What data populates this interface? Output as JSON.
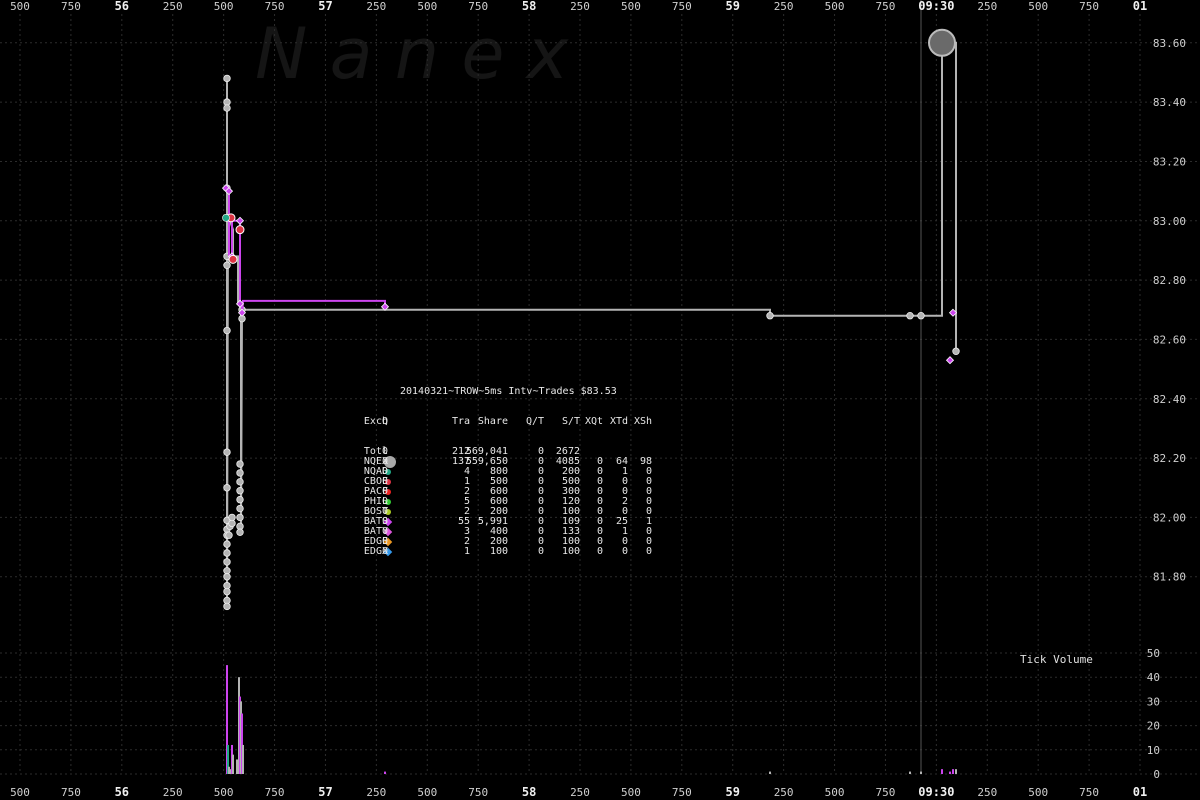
{
  "chart_data": {
    "type": "scatter",
    "title": "20140321~TROW~5ms Intv~Trades $83.53",
    "watermark": "N a n e x",
    "volume_label": "Tick Volume",
    "x_axis_ticks": [
      "500",
      "750",
      "56",
      "250",
      "500",
      "750",
      "57",
      "250",
      "500",
      "750",
      "58",
      "250",
      "500",
      "750",
      "59",
      "250",
      "500",
      "750",
      "09:30",
      "250",
      "500",
      "750",
      "01"
    ],
    "price_axis": {
      "ticks": [
        "83.60",
        "83.40",
        "83.20",
        "83.00",
        "82.80",
        "82.60",
        "82.40",
        "82.20",
        "82.00",
        "81.80"
      ],
      "ylim": [
        81.58,
        83.66
      ]
    },
    "volume_axis": {
      "ticks": [
        "50",
        "40",
        "30",
        "20",
        "10",
        "0"
      ],
      "ylim": [
        0,
        50
      ]
    },
    "x_range": [
      0,
      1200
    ],
    "colors": {
      "background": "#000000",
      "nqex": "#b4b4b4",
      "bats": "#cc44ee",
      "gridline": "#2c2c2c",
      "nqad": "#22aa88",
      "cboe": "#dd3344",
      "pacf": "#ee2222",
      "phil": "#33cc33",
      "bost": "#aacc22",
      "baty": "#dd55dd",
      "edge": "#ee9922",
      "edgx": "#3399ee"
    },
    "series": [
      {
        "name": "NQEX",
        "color": "#b4b4b4",
        "path": [
          [
            227,
            83.48
          ],
          [
            227,
            81.7
          ],
          [
            228,
            83.02
          ],
          [
            233,
            82.97
          ],
          [
            233,
            82.88
          ],
          [
            238,
            82.88
          ],
          [
            238,
            82.72
          ],
          [
            241,
            82.72
          ],
          [
            241,
            82.69
          ],
          [
            241,
            81.94
          ],
          [
            242,
            82.7
          ],
          [
            770,
            82.7
          ],
          [
            770,
            82.68
          ],
          [
            942,
            82.68
          ],
          [
            942,
            83.6
          ],
          [
            956,
            83.6
          ],
          [
            956,
            82.56
          ]
        ],
        "points": [
          [
            227,
            83.48
          ],
          [
            227,
            83.4
          ],
          [
            227,
            83.38
          ],
          [
            227,
            83.11
          ],
          [
            227,
            83.01
          ],
          [
            227,
            82.88
          ],
          [
            227,
            82.85
          ],
          [
            227,
            82.63
          ],
          [
            227,
            82.22
          ],
          [
            227,
            82.1
          ],
          [
            227,
            81.99
          ],
          [
            227,
            81.96
          ],
          [
            227,
            81.94
          ],
          [
            227,
            81.91
          ],
          [
            227,
            81.88
          ],
          [
            227,
            81.85
          ],
          [
            227,
            81.82
          ],
          [
            227,
            81.8
          ],
          [
            227,
            81.77
          ],
          [
            227,
            81.75
          ],
          [
            227,
            81.72
          ],
          [
            227,
            81.7
          ],
          [
            229,
            81.94
          ],
          [
            230,
            81.97
          ],
          [
            232,
            81.98
          ],
          [
            232,
            82.0
          ],
          [
            240,
            82.18
          ],
          [
            240,
            82.15
          ],
          [
            240,
            82.12
          ],
          [
            240,
            82.09
          ],
          [
            240,
            82.06
          ],
          [
            240,
            82.03
          ],
          [
            240,
            82.0
          ],
          [
            240,
            81.97
          ],
          [
            240,
            81.95
          ],
          [
            242,
            82.7
          ],
          [
            242,
            82.67
          ],
          [
            770,
            82.68
          ],
          [
            910,
            82.68
          ],
          [
            921,
            82.68
          ],
          [
            956,
            82.56
          ]
        ],
        "big_point": [
          942,
          83.6
        ]
      },
      {
        "name": "BATS",
        "color": "#cc44ee",
        "path": [
          [
            226,
            83.11
          ],
          [
            229,
            83.11
          ],
          [
            229,
            82.88
          ],
          [
            232,
            82.88
          ],
          [
            232,
            83.0
          ],
          [
            240,
            83.0
          ],
          [
            240,
            82.72
          ],
          [
            242,
            82.72
          ],
          [
            242,
            82.68
          ],
          [
            243,
            82.73
          ],
          [
            385,
            82.73
          ],
          [
            385,
            82.71
          ]
        ],
        "points": [
          [
            226,
            83.11
          ],
          [
            229,
            83.1
          ],
          [
            232,
            82.88
          ],
          [
            240,
            83.0
          ],
          [
            240,
            82.72
          ],
          [
            242,
            82.69
          ],
          [
            385,
            82.71
          ],
          [
            953,
            82.69
          ],
          [
            950,
            82.53
          ]
        ]
      },
      {
        "name": "CBOE",
        "color": "#dd3344",
        "points": [
          [
            231,
            83.01
          ],
          [
            233,
            82.87
          ],
          [
            240,
            82.97
          ]
        ]
      },
      {
        "name": "NQAD",
        "color": "#22aa88",
        "points": [
          [
            226,
            83.01
          ]
        ]
      }
    ],
    "volume_bars": [
      [
        227,
        45,
        "#cc44ee"
      ],
      [
        228,
        12,
        "#22aa88"
      ],
      [
        229,
        3,
        "#b4b4b4"
      ],
      [
        231,
        2,
        "#b4b4b4"
      ],
      [
        232,
        12,
        "#cc44ee"
      ],
      [
        233,
        8,
        "#b4b4b4"
      ],
      [
        237,
        6,
        "#b4b4b4"
      ],
      [
        239,
        40,
        "#b4b4b4"
      ],
      [
        240,
        32,
        "#cc44ee"
      ],
      [
        241,
        30,
        "#b4b4b4"
      ],
      [
        242,
        25,
        "#cc44ee"
      ],
      [
        243,
        12,
        "#b4b4b4"
      ],
      [
        385,
        1,
        "#cc44ee"
      ],
      [
        770,
        1,
        "#b4b4b4"
      ],
      [
        910,
        1,
        "#b4b4b4"
      ],
      [
        921,
        1,
        "#b4b4b4"
      ],
      [
        942,
        2,
        "#cc44ee"
      ],
      [
        950,
        1,
        "#cc44ee"
      ],
      [
        953,
        2,
        "#cc44ee"
      ],
      [
        956,
        2,
        "#b4b4b4"
      ]
    ],
    "vlines": [
      921
    ],
    "grid": true
  },
  "legend": {
    "header": [
      "Exch",
      "Q",
      "Tra",
      "Share",
      "Q/T",
      "S/T",
      "XQt",
      "XTd",
      "XSh"
    ],
    "rows": [
      {
        "exch": "Totl",
        "q": "0",
        "tra": "212",
        "share": "569,041",
        "qt": "0",
        "st": "2672",
        "xqt": "",
        "xtd": "",
        "xsh": "",
        "marker": "none",
        "color": "#000000"
      },
      {
        "exch": "NQEX",
        "q": "0",
        "tra": "137",
        "share": "559,650",
        "qt": "0",
        "st": "4085",
        "xqt": "0",
        "xtd": "64",
        "xsh": "98",
        "marker": "big",
        "color": "#a8a8a8"
      },
      {
        "exch": "NQAD",
        "q": "0",
        "tra": "4",
        "share": "800",
        "qt": "0",
        "st": "200",
        "xqt": "0",
        "xtd": "1",
        "xsh": "0",
        "marker": "dot",
        "color": "#22aa88"
      },
      {
        "exch": "CBOE",
        "q": "0",
        "tra": "1",
        "share": "500",
        "qt": "0",
        "st": "500",
        "xqt": "0",
        "xtd": "0",
        "xsh": "0",
        "marker": "dot",
        "color": "#dd3344"
      },
      {
        "exch": "PACF",
        "q": "0",
        "tra": "2",
        "share": "600",
        "qt": "0",
        "st": "300",
        "xqt": "0",
        "xtd": "0",
        "xsh": "0",
        "marker": "dot",
        "color": "#ee2222"
      },
      {
        "exch": "PHIL",
        "q": "0",
        "tra": "5",
        "share": "600",
        "qt": "0",
        "st": "120",
        "xqt": "0",
        "xtd": "2",
        "xsh": "0",
        "marker": "dot",
        "color": "#33cc33"
      },
      {
        "exch": "BOST",
        "q": "0",
        "tra": "2",
        "share": "200",
        "qt": "0",
        "st": "100",
        "xqt": "0",
        "xtd": "0",
        "xsh": "0",
        "marker": "dot",
        "color": "#aacc22"
      },
      {
        "exch": "BATS",
        "q": "0",
        "tra": "55",
        "share": "5,991",
        "qt": "0",
        "st": "109",
        "xqt": "0",
        "xtd": "25",
        "xsh": "1",
        "marker": "diamond",
        "color": "#cc44ee"
      },
      {
        "exch": "BATY",
        "q": "0",
        "tra": "3",
        "share": "400",
        "qt": "0",
        "st": "133",
        "xqt": "0",
        "xtd": "1",
        "xsh": "0",
        "marker": "diamond",
        "color": "#dd55dd"
      },
      {
        "exch": "EDGE",
        "q": "0",
        "tra": "2",
        "share": "200",
        "qt": "0",
        "st": "100",
        "xqt": "0",
        "xtd": "0",
        "xsh": "0",
        "marker": "diamond",
        "color": "#ee9922"
      },
      {
        "exch": "EDGX",
        "q": "0",
        "tra": "1",
        "share": "100",
        "qt": "0",
        "st": "100",
        "xqt": "0",
        "xtd": "0",
        "xsh": "0",
        "marker": "diamond",
        "color": "#3399ee"
      }
    ]
  }
}
